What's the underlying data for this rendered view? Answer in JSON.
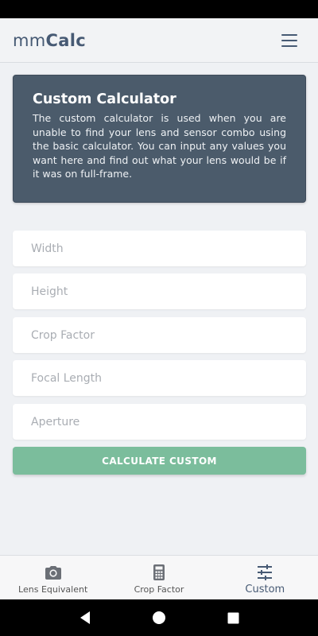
{
  "header": {
    "brand_light": "mm",
    "brand_bold": "Calc"
  },
  "info_card": {
    "title": "Custom Calculator",
    "body": "The custom calculator is used when you are unable to find your lens and sensor combo using the basic calculator. You can input any values you want here and find out what your lens would be if it was on full-frame."
  },
  "form": {
    "width_placeholder": "Width",
    "height_placeholder": "Height",
    "crop_factor_placeholder": "Crop Factor",
    "focal_length_placeholder": "Focal Length",
    "aperture_placeholder": "Aperture",
    "submit_label": "CALCULATE CUSTOM"
  },
  "bottom_nav": {
    "items": [
      {
        "label": "Lens Equivalent",
        "icon": "camera-icon"
      },
      {
        "label": "Crop Factor",
        "icon": "calculator-icon"
      },
      {
        "label": "Custom",
        "icon": "sliders-icon",
        "active": true
      }
    ]
  },
  "colors": {
    "brand": "#475a74",
    "card_bg": "#4b5b6b",
    "accent_button": "#7bbd9c",
    "background": "#eff1f4"
  }
}
